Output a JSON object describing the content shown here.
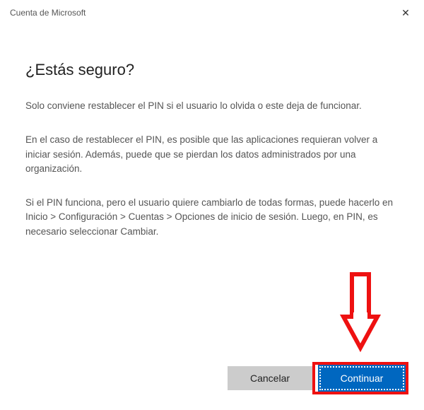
{
  "titlebar": {
    "title": "Cuenta de Microsoft",
    "close_icon": "✕"
  },
  "dialog": {
    "heading": "¿Estás seguro?",
    "paragraph1": "Solo conviene restablecer el PIN si el usuario lo olvida o este deja de funcionar.",
    "paragraph2": "En el caso de restablecer el PIN, es posible que las aplicaciones requieran volver a iniciar sesión. Además, puede que se pierdan los datos administrados por una organización.",
    "paragraph3": "Si el PIN funciona, pero el usuario quiere cambiarlo de todas formas, puede hacerlo en Inicio > Configuración > Cuentas > Opciones de inicio de sesión. Luego, en PIN, es necesario seleccionar Cambiar."
  },
  "buttons": {
    "cancel": "Cancelar",
    "continue": "Continuar"
  }
}
